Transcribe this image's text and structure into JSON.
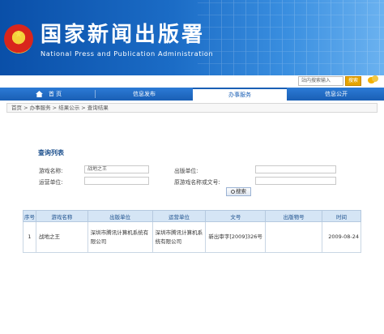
{
  "header": {
    "emblem_glyph": "★",
    "title_cn": "国家新闻出版署",
    "title_en": "National Press and Publication Administration",
    "search_placeholder": "站内搜索输入",
    "search_button": "搜索"
  },
  "nav": {
    "items": [
      "首 页",
      "信息发布",
      "办事服务",
      "信息公开"
    ],
    "active": "办事服务"
  },
  "breadcrumb": [
    "首页",
    "办事服务",
    "结果公示",
    "查询结果"
  ],
  "breadcrumb_sep": " > ",
  "query": {
    "title": "查询列表",
    "fields": {
      "game_name_label": "游戏名称:",
      "game_name_value": "战地之王",
      "publisher_label": "出版单位:",
      "publisher_value": "",
      "operator_label": "运营单位:",
      "operator_value": "",
      "original_label": "原游戏名称或文号:",
      "original_value": ""
    },
    "search_button": "搜索"
  },
  "table": {
    "headers": [
      "序号",
      "游戏名称",
      "出版单位",
      "运营单位",
      "文号",
      "出版物号",
      "时间"
    ],
    "rows": [
      {
        "index": "1",
        "game": "战地之王",
        "publisher": "深圳市腾讯计算机系统有限公司",
        "operator": "深圳市腾讯计算机系统有限公司",
        "doc_no": "新出审字[2009]326号",
        "pub_no": "",
        "date": "2009-08-24"
      }
    ]
  },
  "colors": {
    "banner": "#1b6cc6",
    "nav": "#1a5fb5",
    "table_header": "#d5e5f5",
    "title_text": "#1a4e8c"
  }
}
